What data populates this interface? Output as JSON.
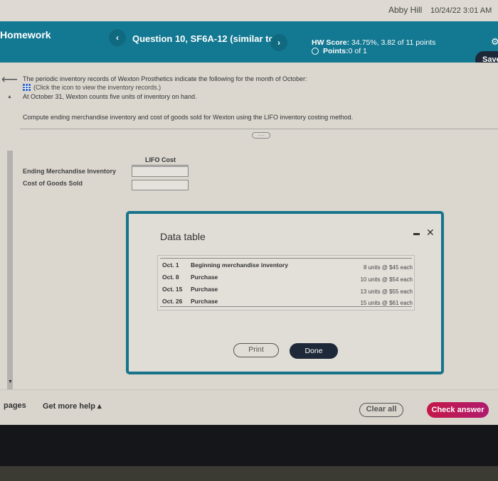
{
  "top_bar": {
    "user_name": "Abby Hill",
    "datetime": "10/24/22 3:01 AM"
  },
  "header": {
    "homework_title": "Homework",
    "prev_glyph": "‹",
    "next_glyph": "›",
    "question_title": "Question 10, SF6A-12 (similar to)",
    "hw_score_label": "HW Score:",
    "hw_score_value": " 34.75%, 3.82 of 11 points",
    "points_label": "Points:",
    "points_value": " 0 of 1",
    "gear_glyph": "⚙",
    "save_label": "Save"
  },
  "question": {
    "back_glyph": "⟵",
    "line1": "The periodic inventory records of Wexton Prosthetics indicate the following for the month of October:",
    "line2": "(Click the icon to view the inventory records.)",
    "line3": "At October 31, Wexton counts five units of inventory on hand.",
    "line4": "Compute ending merchandise inventory and cost of goods sold for Wexton using the LIFO inventory costing method.",
    "more_glyph": "....."
  },
  "answer_table": {
    "column_header": "LIFO Cost",
    "rows": [
      {
        "label": "Ending Merchandise Inventory",
        "value": ""
      },
      {
        "label": "Cost of Goods Sold",
        "value": ""
      }
    ]
  },
  "modal": {
    "title": "Data table",
    "close_glyph": "✕",
    "rows": [
      {
        "date": "Oct. 1",
        "description": "Beginning merchandise inventory",
        "detail": "8 units @ $45 each"
      },
      {
        "date": "Oct. 8",
        "description": "Purchase",
        "detail": "10 units @ $54 each"
      },
      {
        "date": "Oct. 15",
        "description": "Purchase",
        "detail": "13 units @ $55 each"
      },
      {
        "date": "Oct. 26",
        "description": "Purchase",
        "detail": "15 units @ $61 each"
      }
    ],
    "print_label": "Print",
    "done_label": "Done"
  },
  "footer": {
    "pages_label": "pages",
    "help_label": "Get more help ▴",
    "clear_label": "Clear all",
    "check_label": "Check answer"
  },
  "colors": {
    "header_teal": "#137891",
    "primary_dark": "#1d2838",
    "check_answer": "#c41848"
  }
}
